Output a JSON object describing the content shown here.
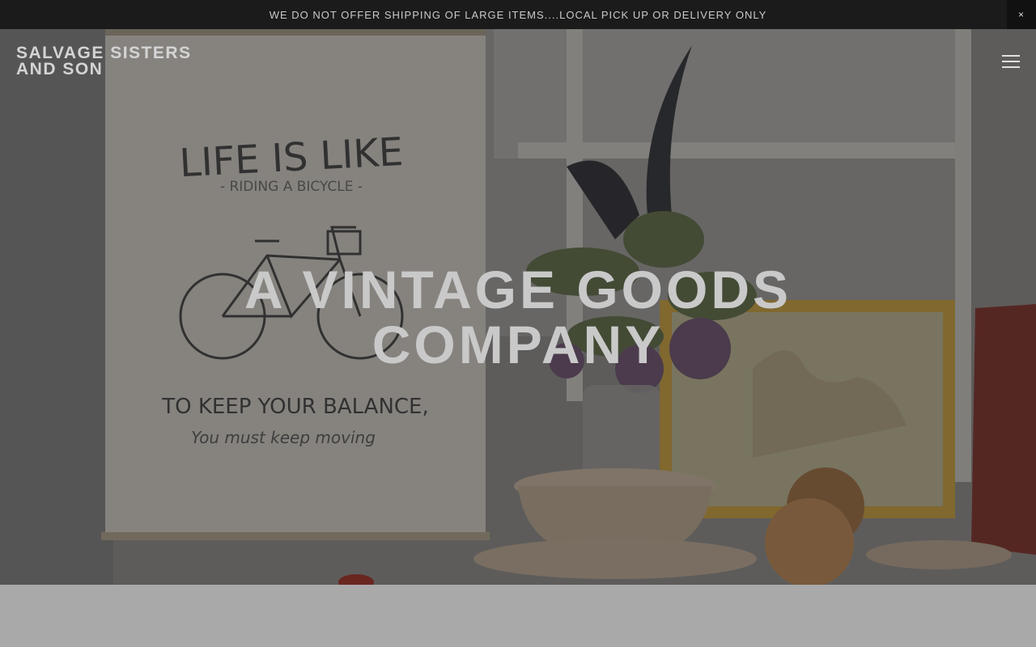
{
  "announcement": {
    "text": "WE DO NOT OFFER SHIPPING OF LARGE ITEMS....LOCAL PICK UP OR DELIVERY ONLY",
    "close_label": "×"
  },
  "header": {
    "logo_line1": "SALVAGE SISTERS",
    "logo_line2": "AND SON",
    "menu_icon": "hamburger-menu-icon"
  },
  "hero": {
    "headline_line1": "A VINTAGE GOODS",
    "headline_line2": "COMPANY",
    "poster_line1": "LIFE IS LIKE",
    "poster_line2": "- RIDING A BICYCLE -",
    "poster_line3": "TO KEEP YOUR BALANCE,",
    "poster_line4": "You must keep moving"
  }
}
